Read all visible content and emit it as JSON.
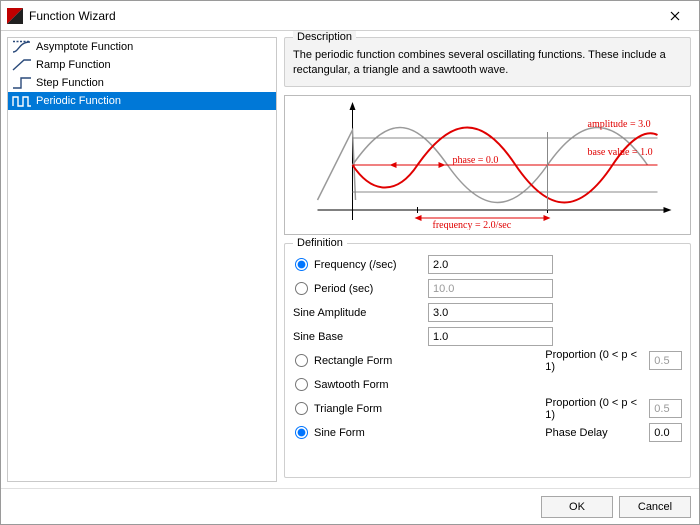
{
  "window": {
    "title": "Function Wizard"
  },
  "sidebar": {
    "items": [
      {
        "label": "Asymptote Function"
      },
      {
        "label": "Ramp Function"
      },
      {
        "label": "Step Function"
      },
      {
        "label": "Periodic Function"
      }
    ],
    "selected_index": 3
  },
  "description": {
    "heading": "Description",
    "text": "The periodic function combines several oscillating functions. These include a rectangular, a triangle and a sawtooth wave."
  },
  "preview": {
    "annotations": {
      "amplitude": "amplitude = 3.0",
      "phase": "phase = 0.0",
      "base": "base value = 1.0",
      "frequency": "frequency = 2.0/sec"
    }
  },
  "definition": {
    "heading": "Definition",
    "rows": {
      "frequency": {
        "label": "Frequency (/sec)",
        "value": "2.0"
      },
      "period": {
        "label": "Period (sec)",
        "value": "10.0"
      },
      "sine_amp": {
        "label": "Sine Amplitude",
        "value": "3.0"
      },
      "sine_base": {
        "label": "Sine Base",
        "value": "1.0"
      },
      "rectangle": {
        "label": "Rectangle Form",
        "prop_label": "Proportion (0 < p < 1)",
        "prop_value": "0.5"
      },
      "sawtooth": {
        "label": "Sawtooth Form"
      },
      "triangle": {
        "label": "Triangle Form",
        "prop_label": "Proportion (0 < p < 1)",
        "prop_value": "0.5"
      },
      "sine": {
        "label": "Sine Form",
        "phase_label": "Phase Delay",
        "phase_value": "0.0"
      }
    }
  },
  "buttons": {
    "ok": "OK",
    "cancel": "Cancel"
  }
}
